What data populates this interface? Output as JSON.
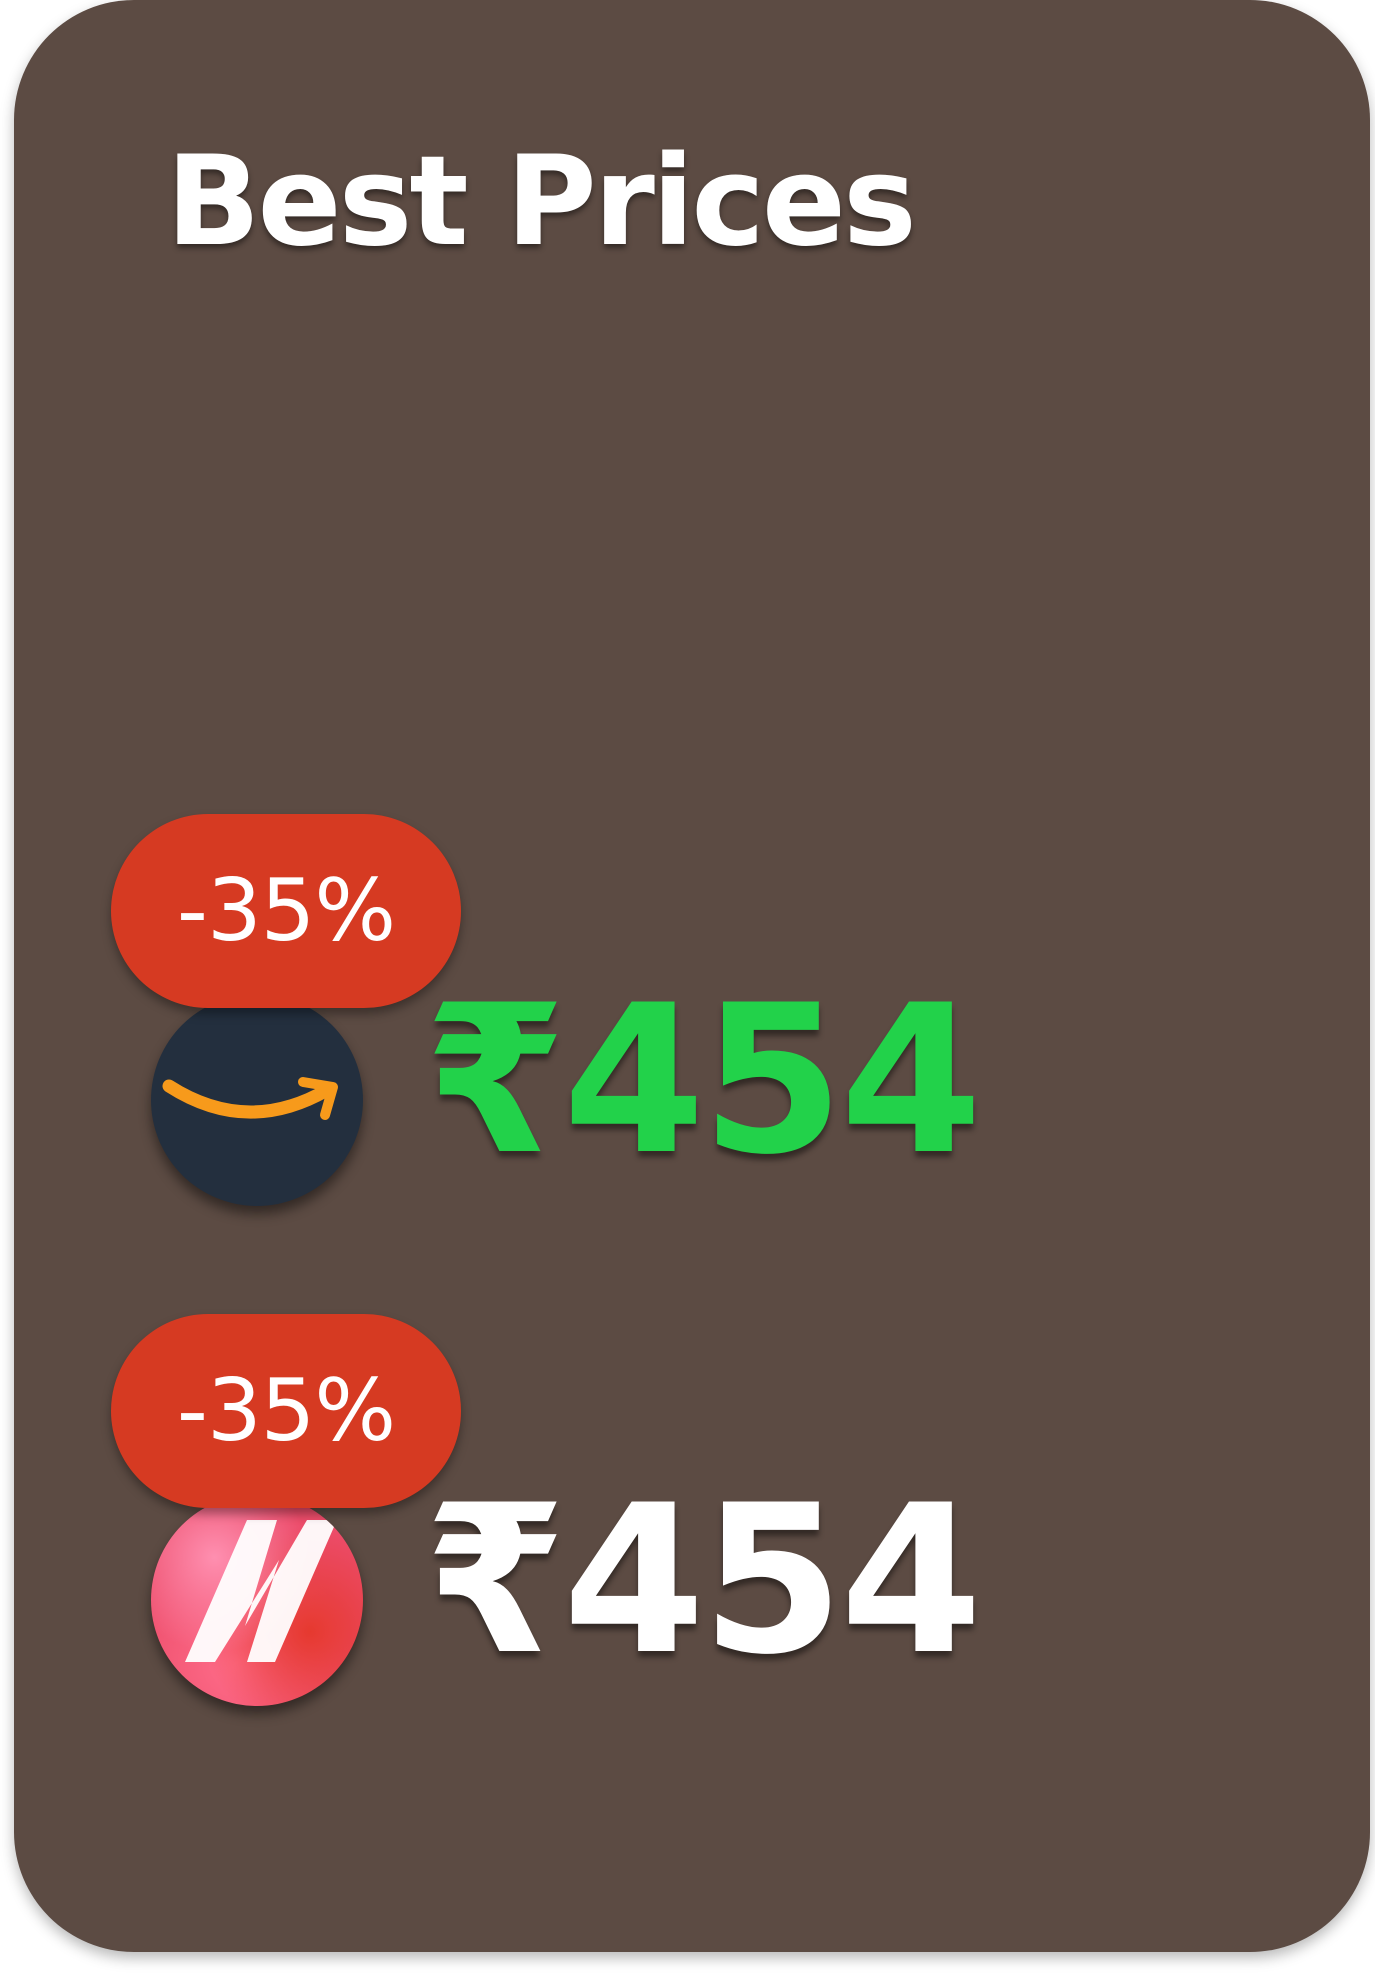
{
  "card": {
    "title": "Best Prices",
    "background_color": "#5c4b43"
  },
  "offers": [
    {
      "store_icon": "amazon-logo-icon",
      "discount": "-35%",
      "price": "₹454",
      "price_color": "#22d24a"
    },
    {
      "store_icon": "nykaa-logo-icon",
      "discount": "-35%",
      "price": "₹454",
      "price_color": "#ffffff"
    }
  ],
  "colors": {
    "badge": "#d63a22",
    "best_price": "#22d24a",
    "text": "#ffffff"
  }
}
